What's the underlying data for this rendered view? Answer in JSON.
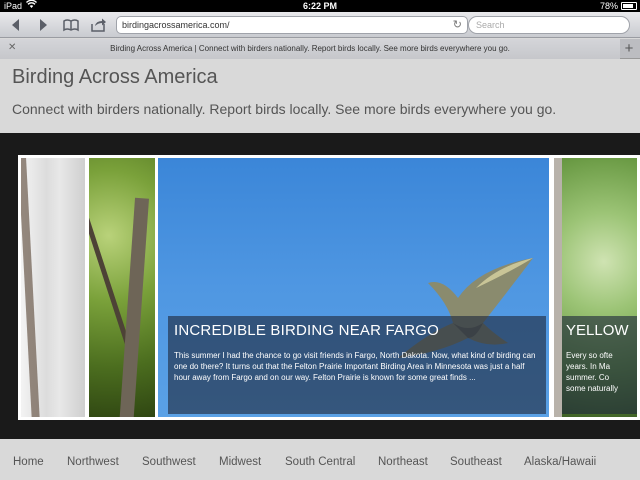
{
  "status": {
    "device": "iPad",
    "wifi": "wifi-icon",
    "time": "6:22 PM",
    "battery": "78%"
  },
  "toolbar": {
    "url": "birdingacrossamerica.com/",
    "search_placeholder": "Search",
    "icons": [
      "back-icon",
      "forward-icon",
      "bookmarks-icon",
      "share-icon",
      "reload-icon"
    ]
  },
  "tab": {
    "title": "Birding Across America | Connect with birders nationally. Report birds locally. See more birds everywhere you go."
  },
  "site": {
    "title": "Birding Across America",
    "tagline": "Connect with birders nationally. Report birds locally. See more birds everywhere you go."
  },
  "slider": {
    "main": {
      "heading": "INCREDIBLE BIRDING NEAR FARGO",
      "body": "This summer I had the chance to go visit friends in Fargo, North Dakota.  Now, what kind of birding can one do there?  It turns out that the Felton Prairie Important Birding Area in Minnesota was just a half hour away from Fargo and on our way.  Felton Prairie is known for some great finds ..."
    },
    "side": {
      "heading": "YELLOW",
      "body": "Every so ofte\nyears.  In Ma\nsummer.  Co\nsome naturally"
    }
  },
  "nav": [
    "Home",
    "Northwest",
    "Southwest",
    "Midwest",
    "South Central",
    "Northeast",
    "Southeast",
    "Alaska/Hawaii"
  ]
}
